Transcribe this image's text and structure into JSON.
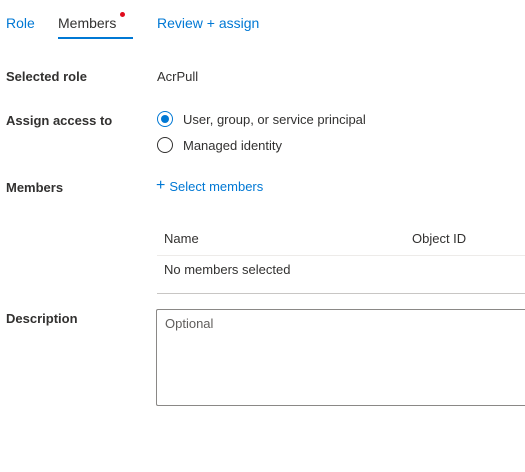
{
  "tabs": [
    {
      "label": "Role"
    },
    {
      "label": "Members",
      "active": true,
      "has_indicator": true
    },
    {
      "label": "Review + assign"
    }
  ],
  "form": {
    "selected_role": {
      "label": "Selected role",
      "value": "AcrPull"
    },
    "assign_access_to": {
      "label": "Assign access to",
      "options": [
        {
          "label": "User, group, or service principal",
          "selected": true
        },
        {
          "label": "Managed identity",
          "selected": false
        }
      ]
    },
    "members": {
      "label": "Members",
      "select_link": "Select members",
      "table": {
        "columns": [
          "Name",
          "Object ID"
        ],
        "empty_text": "No members selected"
      }
    },
    "description": {
      "label": "Description",
      "placeholder": "Optional",
      "value": ""
    }
  },
  "colors": {
    "accent": "#0078d4",
    "indicator": "#e00b1c",
    "text": "#323130"
  }
}
